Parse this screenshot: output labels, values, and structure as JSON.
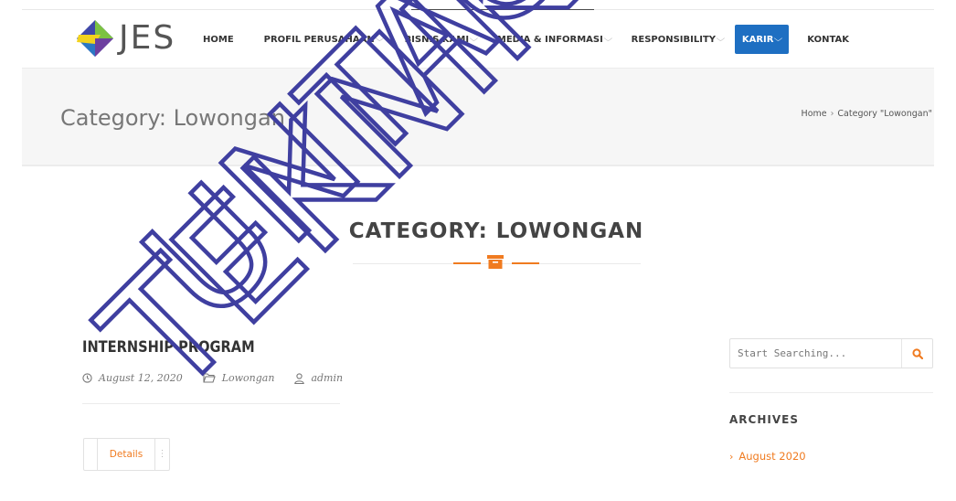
{
  "header": {
    "logo_text": "JES",
    "nav": [
      {
        "label": "HOME",
        "dropdown": false,
        "active": false
      },
      {
        "label": "PROFIL PERUSAHAAN",
        "dropdown": true,
        "active": false
      },
      {
        "label": "BISNIS KAMI",
        "dropdown": true,
        "active": false
      },
      {
        "label": "MEDIA & INFORMASI",
        "dropdown": true,
        "active": false
      },
      {
        "label": "RESPONSIBILITY",
        "dropdown": true,
        "active": false
      },
      {
        "label": "KARIR",
        "dropdown": true,
        "active": true
      },
      {
        "label": "KONTAK",
        "dropdown": false,
        "active": false
      }
    ]
  },
  "band": {
    "title": "Category: Lowongan",
    "breadcrumb": {
      "home": "Home",
      "separator": "›",
      "current": "Category \"Lowongan\""
    }
  },
  "main": {
    "heading": "CATEGORY: LOWONGAN",
    "heading_icon": "archive-icon",
    "post": {
      "title": "INTERNSHIP PROGRAM",
      "date": "August 12, 2020",
      "category": "Lowongan",
      "author": "admin",
      "button_label": "Details"
    }
  },
  "sidebar": {
    "search_placeholder": "Start Searching...",
    "search_icon": "search-icon",
    "archives_title": "ARCHIVES",
    "archives": [
      "August 2020"
    ]
  },
  "watermark": {
    "lines": [
      "TEKNIK",
      "UNTAG"
    ]
  },
  "colors": {
    "accent": "#f07b20",
    "nav_active": "#1e6fc2",
    "watermark": "#3f3fa0"
  }
}
